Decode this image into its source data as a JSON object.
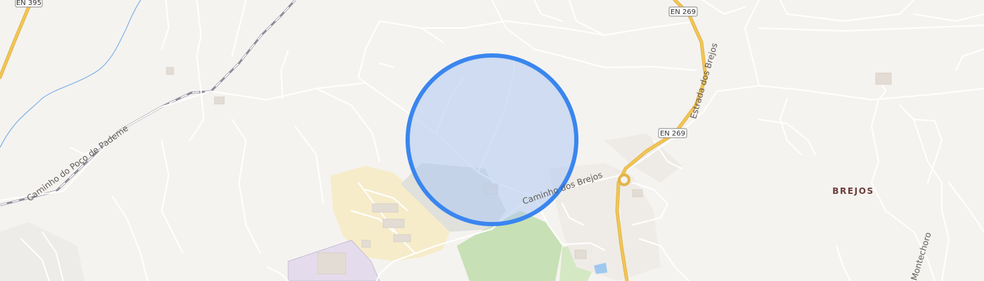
{
  "map": {
    "road_labels": {
      "caminho_dos_brejos": "Caminho dos Brejos",
      "estrada_dos_brejos": "Estrada dos Brejos",
      "caminho_poco_pademe": "Caminho do Poço de Pademe",
      "montechoro": "Montechoro"
    },
    "shields": {
      "en395": "EN 395",
      "en269_top": "EN 269",
      "en269_mid": "EN 269"
    },
    "place_labels": {
      "brejos": "BREJOS"
    }
  },
  "colors": {
    "background": "#f5f3f0",
    "minor_road": "#ffffff",
    "major_road": "#f2c654",
    "water": "#7fb3e6",
    "rail": "#8c8c99",
    "accuracy_fill": "#aec8f2",
    "accuracy_stroke": "#3a86ef",
    "park": "#c8e0b6",
    "industrial": "#f6ecca",
    "commercial": "#e4dcec"
  }
}
